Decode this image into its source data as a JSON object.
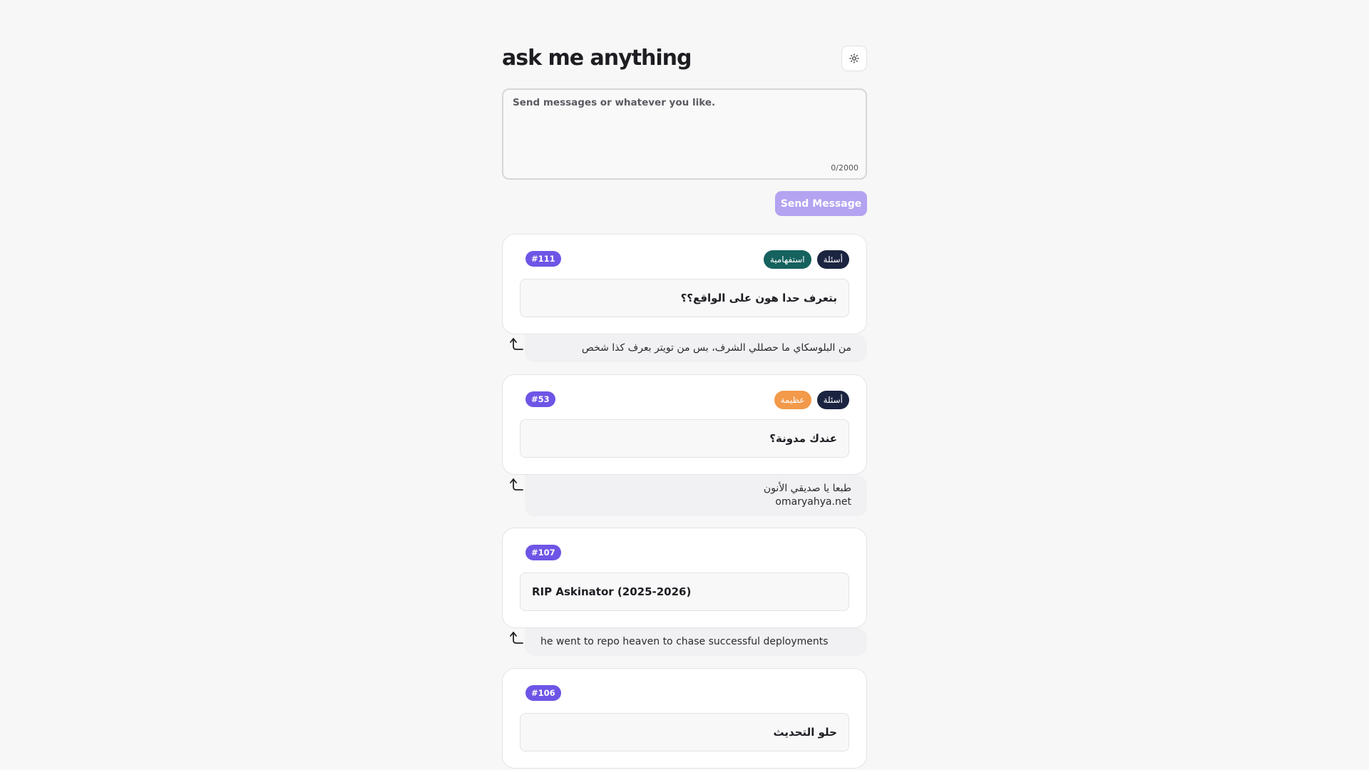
{
  "header": {
    "title": "ask me anything",
    "theme_icon": "sun-icon"
  },
  "composer": {
    "placeholder": "Send messages or whatever you like.",
    "value": "",
    "counter": "0/2000",
    "send_label": "Send Message"
  },
  "colors": {
    "accent": "#6e55e6",
    "send_disabled": "#b3a3f1",
    "tag_questions": "#1b2440",
    "tag_interrogative": "#15625e",
    "tag_great": "#f2994a"
  },
  "messages": [
    {
      "number": "#111",
      "tags": [
        "أسئلة",
        "استفهامية"
      ],
      "question": "بتعرف حدا هون على الواقع؟؟",
      "answer": "من البلوسكاي ما حصللي الشرف، بس من تويتر بعرف كذا شخص"
    },
    {
      "number": "#53",
      "tags": [
        "أسئلة",
        "عظيمة"
      ],
      "question": "عندك مدونة؟",
      "answer_lines": [
        "طبعا يا صديقي الأنون",
        "omaryahya.net"
      ]
    },
    {
      "number": "#107",
      "tags": [],
      "question": "RIP Askinator (2025-2026)",
      "answer": "he went to repo heaven to chase successful deployments"
    },
    {
      "number": "#106",
      "tags": [],
      "question": "حلو التحديث"
    }
  ]
}
